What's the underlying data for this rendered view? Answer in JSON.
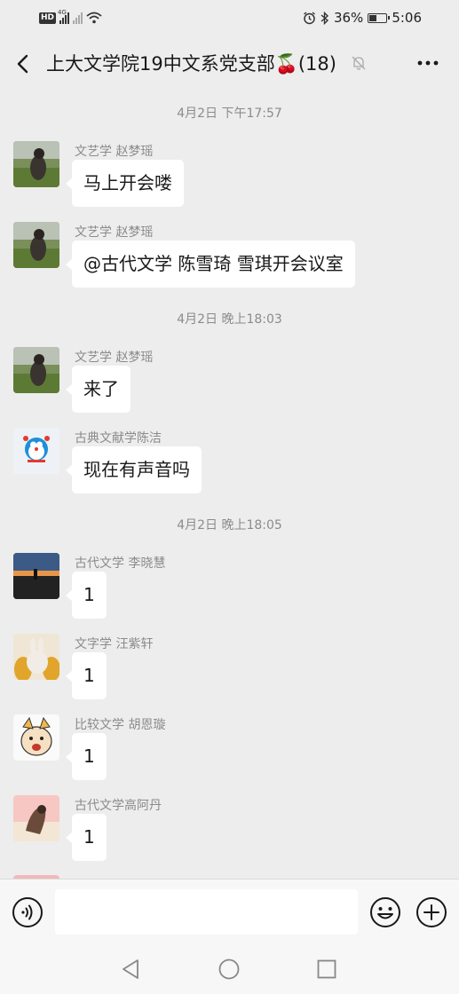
{
  "status_bar": {
    "hd_label": "HD",
    "network_label": "4G",
    "battery": "36%",
    "time": "5:06"
  },
  "header": {
    "title": "上大文学院19中文系党支部🍒(18)"
  },
  "chat": {
    "timestamps": [
      "4月2日 下午17:57",
      "4月2日 晚上18:03",
      "4月2日 晚上18:05"
    ],
    "messages": [
      {
        "sender": "文艺学 赵梦瑶",
        "text": "马上开会喽"
      },
      {
        "sender": "文艺学 赵梦瑶",
        "text": "@古代文学 陈雪琦  雪琪开会议室"
      },
      {
        "sender": "文艺学 赵梦瑶",
        "text": "来了"
      },
      {
        "sender": "古典文献学陈洁",
        "text": "现在有声音吗"
      },
      {
        "sender": "古代文学 李晓慧",
        "text": "1"
      },
      {
        "sender": "文字学 汪紫轩",
        "text": "1"
      },
      {
        "sender": "比较文学 胡恩璇",
        "text": "1"
      },
      {
        "sender": "古代文学高阿丹",
        "text": "1"
      }
    ]
  },
  "input": {
    "value": "",
    "placeholder": ""
  },
  "colors": {
    "background": "#ededed",
    "bubble": "#ffffff",
    "meta_text": "#8b8b8b"
  },
  "icons": [
    "back-icon",
    "mute-bell-icon",
    "more-icon",
    "voice-icon",
    "emoji-icon",
    "plus-icon",
    "nav-back-icon",
    "nav-home-icon",
    "nav-recent-icon"
  ]
}
